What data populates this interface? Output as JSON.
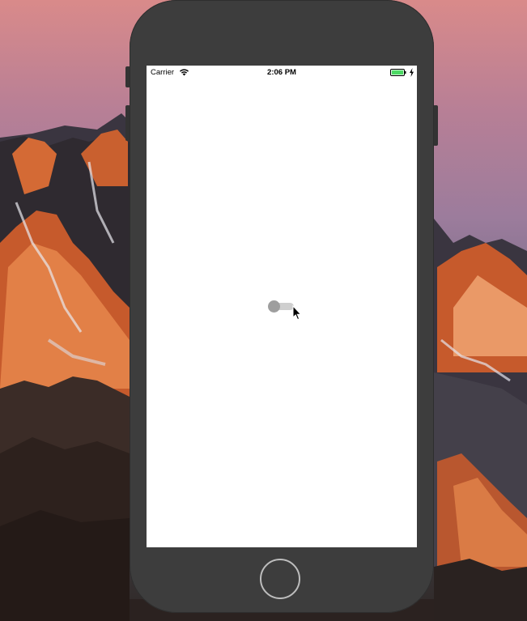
{
  "status_bar": {
    "carrier": "Carrier",
    "time": "2:06 PM",
    "wifi_icon": "wifi-icon",
    "battery_icon": "battery-icon",
    "charging_icon": "charging-bolt-icon",
    "battery_color": "#4cd964"
  },
  "toggle": {
    "state": "off",
    "track_color": "#cfcfcf",
    "thumb_color": "#9e9e9e"
  },
  "home_button": {
    "icon": "home-button"
  },
  "cursor": {
    "icon": "arrow-cursor-icon"
  }
}
